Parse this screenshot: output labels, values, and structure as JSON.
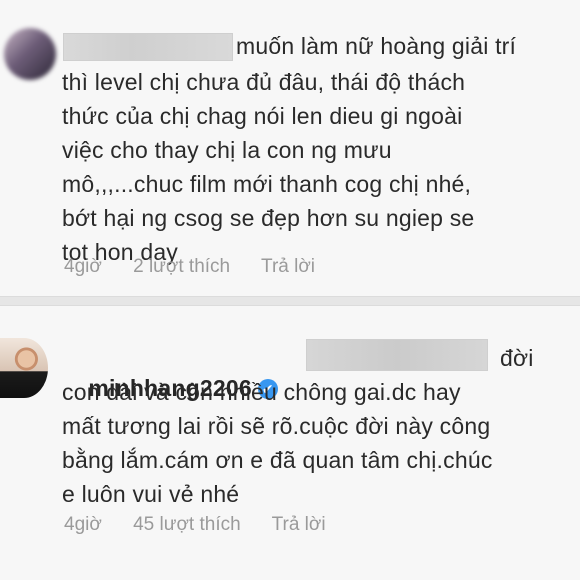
{
  "comments": [
    {
      "line1_after_redaction": "muốn làm nữ hoàng giải trí",
      "lines": [
        "thì level chị chưa đủ đâu, thái độ thách",
        "thức của chị chag nói len dieu gi ngoài",
        "việc cho thay chị la con ng mưu",
        "mô,,,...chuc film mới thanh cog chị nhé,",
        "bớt hại ng csog se đẹp hơn su ngiep se",
        "tot hon day"
      ],
      "time": "4giờ",
      "likes": "2 lượt thích",
      "reply": "Trả lời"
    },
    {
      "username": "minhhang2206",
      "verified_icon": "✔",
      "line1_after_redaction": "đời",
      "lines": [
        "con dài và còn nhiều chông gai.dc hay",
        "mất tương lai rồi sẽ rõ.cuộc đời này công",
        "bằng lắm.cám ơn e đã quan tâm chị.chúc",
        "e luôn vui vẻ nhé"
      ],
      "time": "4giờ",
      "likes": "45 lượt thích",
      "reply": "Trả lời"
    }
  ],
  "colors": {
    "verified": "#3897f0",
    "meta_text": "#9a9a9a"
  }
}
